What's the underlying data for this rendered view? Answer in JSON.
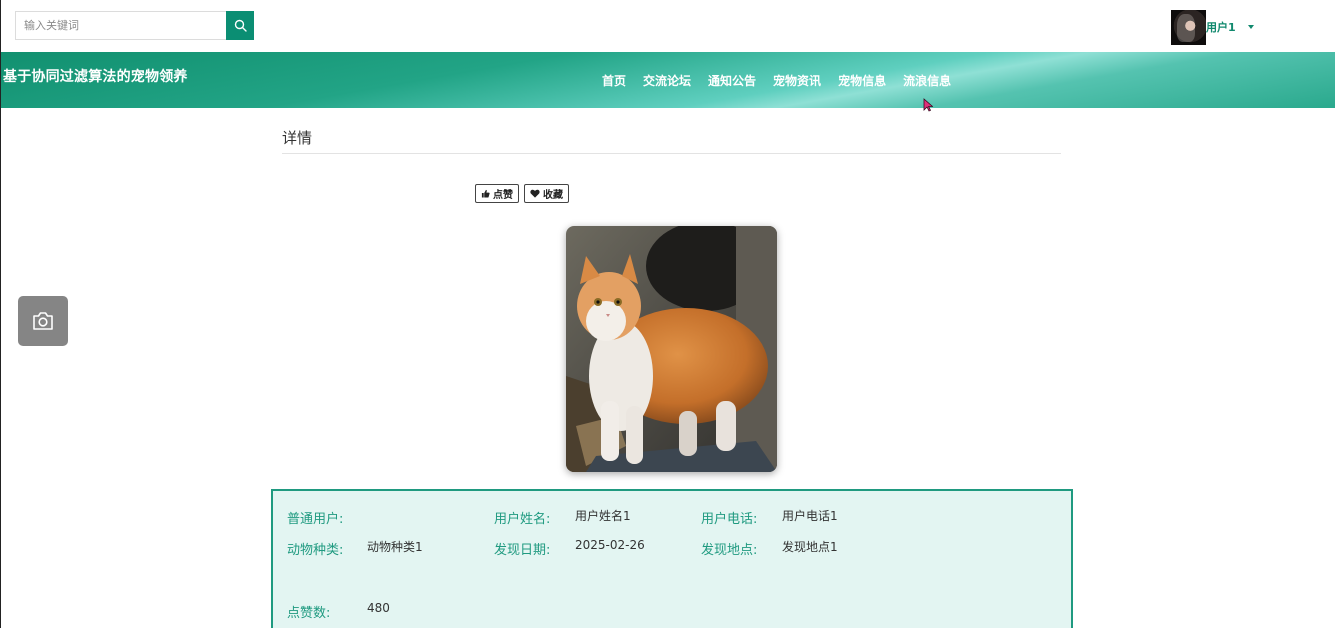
{
  "search": {
    "placeholder": "输入关键词",
    "icon": "search-icon"
  },
  "user": {
    "name": "用户1",
    "avatar_icon": "avatar-photo",
    "caret_icon": "caret-down-icon"
  },
  "site": {
    "title": "基于协同过滤算法的宠物领养"
  },
  "nav": {
    "items": [
      {
        "label": "首页"
      },
      {
        "label": "交流论坛"
      },
      {
        "label": "通知公告"
      },
      {
        "label": "宠物资讯"
      },
      {
        "label": "宠物信息"
      },
      {
        "label": "流浪信息"
      }
    ]
  },
  "page": {
    "section_title": "详情"
  },
  "actions": {
    "like_label": "点赞",
    "favorite_label": "收藏"
  },
  "details": {
    "user_type_label": "普通用户:",
    "user_type_value": "",
    "user_name_label": "用户姓名:",
    "user_name_value": "用户姓名1",
    "user_phone_label": "用户电话:",
    "user_phone_value": "用户电话1",
    "animal_type_label": "动物种类:",
    "animal_type_value": "动物种类1",
    "found_date_label": "发现日期:",
    "found_date_value": "2025-02-26",
    "found_place_label": "发现地点:",
    "found_place_value": "发现地点1",
    "likes_label": "点赞数:",
    "likes_value": "480"
  },
  "colors": {
    "accent": "#0b8e73",
    "label_green": "#1f9a80",
    "info_bg": "#e3f5f2"
  }
}
